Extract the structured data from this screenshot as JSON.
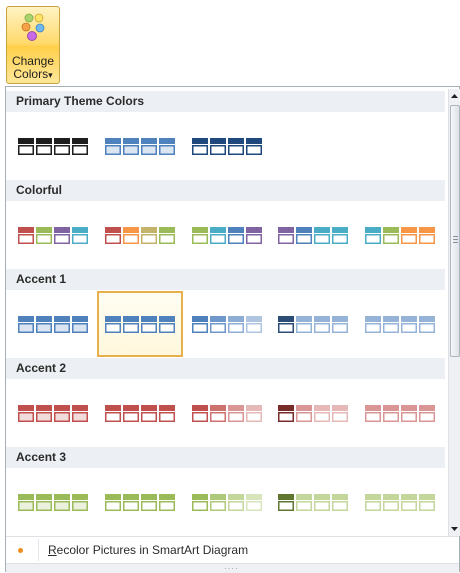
{
  "button": {
    "label_line1": "Change",
    "label_line2": "Colors",
    "arrow": "▾"
  },
  "sections": [
    {
      "title": "Primary Theme Colors",
      "swatches": [
        {
          "colors": [
            "#1e1e1e",
            "#1e1e1e",
            "#1e1e1e",
            "#1e1e1e"
          ],
          "fill": "#ffffff",
          "selected": false
        },
        {
          "colors": [
            "#4f81bd",
            "#4f81bd",
            "#4f81bd",
            "#4f81bd"
          ],
          "fill": "#dbe5f1",
          "selected": false
        },
        {
          "colors": [
            "#1f497d",
            "#1f497d",
            "#1f497d",
            "#1f497d"
          ],
          "fill": "#ffffff",
          "selected": false
        }
      ]
    },
    {
      "title": "Colorful",
      "swatches": [
        {
          "colors": [
            "#c0504d",
            "#9bbb59",
            "#8064a2",
            "#4bacc6"
          ],
          "fill": "#ffffff",
          "selected": false
        },
        {
          "colors": [
            "#c0504d",
            "#f79646",
            "#c4b36b",
            "#9bbb59"
          ],
          "fill": "#ffffff",
          "selected": false
        },
        {
          "colors": [
            "#9bbb59",
            "#4bacc6",
            "#4f81bd",
            "#8064a2"
          ],
          "fill": "#ffffff",
          "selected": false
        },
        {
          "colors": [
            "#8064a2",
            "#4f81bd",
            "#4bacc6",
            "#4bacc6"
          ],
          "fill": "#ffffff",
          "selected": false
        },
        {
          "colors": [
            "#4bacc6",
            "#9bbb59",
            "#f79646",
            "#f79646"
          ],
          "fill": "#ffffff",
          "selected": false
        }
      ]
    },
    {
      "title": "Accent 1",
      "swatches": [
        {
          "colors": [
            "#4f81bd",
            "#4f81bd",
            "#4f81bd",
            "#4f81bd"
          ],
          "fill": "#dbe5f1",
          "selected": false
        },
        {
          "colors": [
            "#4f81bd",
            "#4f81bd",
            "#4f81bd",
            "#4f81bd"
          ],
          "fill": "#ffffff",
          "selected": true
        },
        {
          "colors": [
            "#4f81bd",
            "#6f97c9",
            "#8eadd4",
            "#aec4df"
          ],
          "fill": "#ffffff",
          "selected": false
        },
        {
          "colors": [
            "#2c4d75",
            "#95b3d7",
            "#95b3d7",
            "#95b3d7"
          ],
          "fill": "#ffffff",
          "selected": false
        },
        {
          "colors": [
            "#95b3d7",
            "#95b3d7",
            "#95b3d7",
            "#95b3d7"
          ],
          "fill": "#ffffff",
          "selected": false
        }
      ]
    },
    {
      "title": "Accent 2",
      "swatches": [
        {
          "colors": [
            "#c0504d",
            "#c0504d",
            "#c0504d",
            "#c0504d"
          ],
          "fill": "#f2dcdb",
          "selected": false
        },
        {
          "colors": [
            "#c0504d",
            "#c0504d",
            "#c0504d",
            "#c0504d"
          ],
          "fill": "#ffffff",
          "selected": false
        },
        {
          "colors": [
            "#c0504d",
            "#cd736f",
            "#d99694",
            "#e5b9b7"
          ],
          "fill": "#ffffff",
          "selected": false
        },
        {
          "colors": [
            "#772c2a",
            "#d99694",
            "#e6b9b8",
            "#e6b9b8"
          ],
          "fill": "#ffffff",
          "selected": false
        },
        {
          "colors": [
            "#d99694",
            "#d99694",
            "#d99694",
            "#d99694"
          ],
          "fill": "#ffffff",
          "selected": false
        }
      ]
    },
    {
      "title": "Accent 3",
      "swatches": [
        {
          "colors": [
            "#9bbb59",
            "#9bbb59",
            "#9bbb59",
            "#9bbb59"
          ],
          "fill": "#ebf1dd",
          "selected": false
        },
        {
          "colors": [
            "#9bbb59",
            "#9bbb59",
            "#9bbb59",
            "#9bbb59"
          ],
          "fill": "#ffffff",
          "selected": false
        },
        {
          "colors": [
            "#9bbb59",
            "#afc97a",
            "#c3d69b",
            "#d7e4bc"
          ],
          "fill": "#ffffff",
          "selected": false
        },
        {
          "colors": [
            "#5f7530",
            "#c3d69b",
            "#c3d69b",
            "#c3d69b"
          ],
          "fill": "#ffffff",
          "selected": false
        },
        {
          "colors": [
            "#c3d69b",
            "#c3d69b",
            "#c3d69b",
            "#c3d69b"
          ],
          "fill": "#ffffff",
          "selected": false
        }
      ]
    }
  ],
  "footer": {
    "text_first": "R",
    "text_rest": "ecolor Pictures in SmartArt Diagram"
  },
  "icons": {
    "button_icon": "color-dots-icon",
    "scroll_up": "scroll-up-arrow-icon",
    "scroll_down": "scroll-down-arrow-icon",
    "footer_bullet": "bullet-icon"
  }
}
